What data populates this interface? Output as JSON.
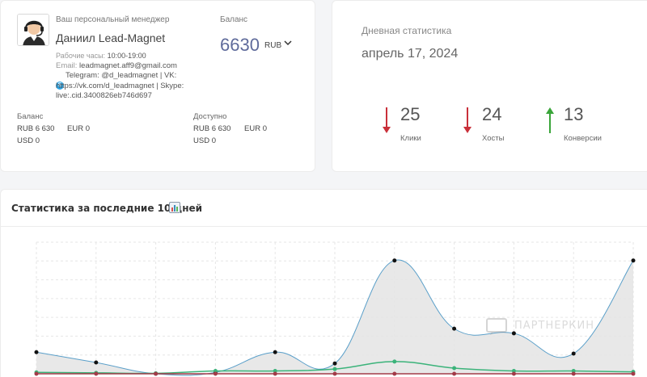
{
  "manager": {
    "caption": "Ваш персональный менеджер",
    "name": "Даниил Lead-Magnet",
    "hours_label": "Рабочие часы:",
    "hours_value": "10:00-19:00",
    "email_label": "Email:",
    "email_value": "leadmagnet.aff9@gmail.com",
    "contacts_line1": "Telegram: @d_leadmagnet | VK:",
    "contacts_line2": "https://vk.com/d_leadmagnet | Skype:",
    "contacts_line3": "live:.cid.3400826eb746d697",
    "avatar_icon": "manager-headset-avatar-icon",
    "skype_icon": "skype-icon"
  },
  "balance": {
    "caption": "Баланс",
    "amount": "6630",
    "currency": "RUB",
    "chevron_icon": "chevron-down-icon",
    "accent_color": "#5f6b9b"
  },
  "balance_detail": {
    "caption": "Баланс",
    "rub": "RUB 6 630",
    "eur": "EUR 0",
    "usd": "USD 0"
  },
  "available_detail": {
    "caption": "Доступно",
    "rub": "RUB 6 630",
    "eur": "EUR 0",
    "usd": "USD 0"
  },
  "daily": {
    "title": "Дневная статистика",
    "date": "апрель 17, 2024",
    "stats": [
      {
        "value": "25",
        "label": "Клики",
        "trend": "down",
        "color": "#c9303a"
      },
      {
        "value": "24",
        "label": "Хосты",
        "trend": "down",
        "color": "#c9303a"
      },
      {
        "value": "13",
        "label": "Конверсии",
        "trend": "up",
        "color": "#3aa53a"
      }
    ]
  },
  "stats_section": {
    "title": "Статистика за последние 10 дней",
    "title_icon": "bar-chart-icon",
    "watermark": "ПАРТНЕРКИН"
  },
  "chart_data": {
    "type": "area",
    "grid": true,
    "x": [
      0,
      1,
      2,
      3,
      4,
      5,
      6,
      7,
      8,
      9,
      10
    ],
    "series": [
      {
        "values": [
          46,
          24,
          0,
          3,
          46,
          22,
          241,
          96,
          86,
          43,
          241
        ],
        "color": "#5a9fc9",
        "fill": "#e4e4e4",
        "marker": "#111111"
      },
      {
        "values": [
          3,
          2,
          1,
          6,
          6,
          10,
          26,
          12,
          6,
          6,
          4
        ],
        "color": "#3bb37a",
        "marker": "#3bb37a"
      },
      {
        "values": [
          0,
          0,
          0,
          0,
          0,
          0,
          0,
          0,
          0,
          0,
          0
        ],
        "color": "#a33a48",
        "marker": "#a33a48"
      }
    ],
    "ylim": [
      0,
      280
    ]
  }
}
